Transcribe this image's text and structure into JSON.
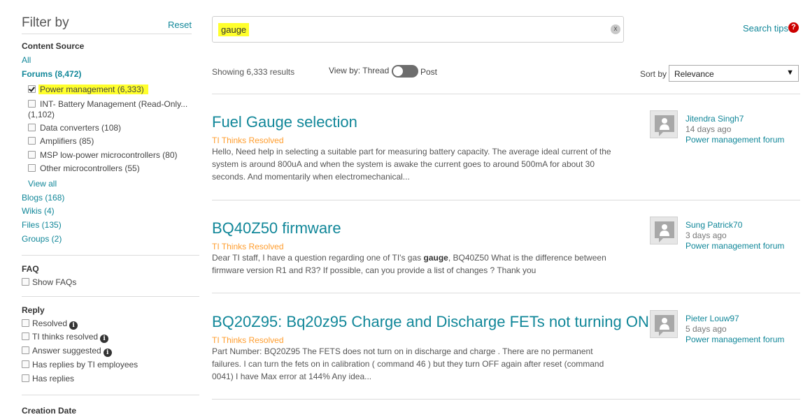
{
  "sidebar": {
    "title": "Filter by",
    "reset": "Reset",
    "content_source": {
      "title": "Content Source",
      "all": "All",
      "forums": "Forums (8,472)",
      "forum_items": [
        {
          "label": "Power management (6,333)",
          "checked": true
        },
        {
          "label": "INT- Battery Management (Read-Only...",
          "label2": "(1,102)",
          "checked": false
        },
        {
          "label": "Data converters (108)",
          "checked": false
        },
        {
          "label": "Amplifiers (85)",
          "checked": false
        },
        {
          "label": "MSP low-power microcontrollers (80)",
          "checked": false
        },
        {
          "label": "Other microcontrollers (55)",
          "checked": false
        }
      ],
      "view_all": "View all",
      "blogs": "Blogs (168)",
      "wikis": "Wikis (4)",
      "files": "Files (135)",
      "groups": "Groups (2)"
    },
    "faq": {
      "title": "FAQ",
      "show_faqs": "Show FAQs"
    },
    "reply": {
      "title": "Reply",
      "items": [
        {
          "label": "Resolved",
          "info": true
        },
        {
          "label": "TI thinks resolved",
          "info": true
        },
        {
          "label": "Answer suggested",
          "info": true
        },
        {
          "label": "Has replies by TI employees",
          "info": false
        },
        {
          "label": "Has replies",
          "info": false
        }
      ]
    },
    "creation_date": {
      "title": "Creation Date"
    }
  },
  "search": {
    "value": "gauge",
    "clear": "x",
    "tips": "Search tips",
    "help": "?"
  },
  "results_bar": {
    "count": "Showing 6,333 results",
    "view_by": "View by: Thread",
    "post": "Post",
    "sort_label": "Sort by",
    "sort_value": "Relevance",
    "sort_arrow": "▼"
  },
  "results": [
    {
      "title": "Fuel Gauge selection",
      "status": "TI Thinks Resolved",
      "snippet": [
        "Hello, Need help in selecting a suitable part for measuring battery capacity. The average ideal current of the",
        "system is around 800uA and when the system is awake the current goes to around 500mA for about 30",
        "seconds. And momentarily when electromechanical..."
      ],
      "author": "Jitendra Singh7",
      "time": "14 days ago",
      "forum": "Power management forum"
    },
    {
      "title": "BQ40Z50 firmware",
      "status": "TI Thinks Resolved",
      "snippet_before": "Dear TI staff, I have a question regarding one of TI's gas ",
      "snippet_bold": "gauge",
      "snippet_after": ", BQ40Z50 What is the difference between",
      "snippet2": "firmware version R1 and R3? If possible, can you provide a list of changes ? Thank you",
      "author": "Sung Patrick70",
      "time": "3 days ago",
      "forum": "Power management forum"
    },
    {
      "title": "BQ20Z95: Bq20z95 Charge and Discharge FETs not turning ON",
      "status": "TI Thinks Resolved",
      "snippet": [
        "Part Number: BQ20Z95 The FETS does not turn on in discharge and charge . There are no permanent",
        "failures. I can turn the fets on in calibration ( command 46 ) but they turn OFF again after reset (command",
        "0041) I have Max error at 144% Any idea..."
      ],
      "author": "Pieter Louw97",
      "time": "5 days ago",
      "forum": "Power management forum"
    }
  ],
  "icons": {
    "checkbox": "checkbox-icon",
    "info": "info-icon",
    "avatar": "user-avatar-icon",
    "clear": "clear-search-icon",
    "help": "help-icon",
    "dropdown": "chevron-down-icon"
  },
  "colors": {
    "link": "#118799",
    "status": "#ff9d2e",
    "highlight": "#ffff2c",
    "help": "#cc0000"
  }
}
